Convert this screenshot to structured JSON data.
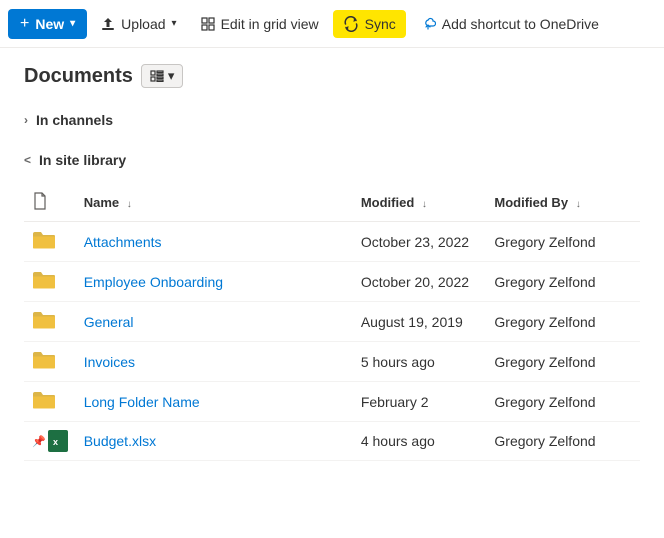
{
  "toolbar": {
    "new_label": "New",
    "upload_label": "Upload",
    "edit_grid_label": "Edit in grid view",
    "sync_label": "Sync",
    "add_shortcut_label": "Add shortcut to OneDrive"
  },
  "page": {
    "title": "Documents",
    "view_icon": "layout-icon",
    "view_dropdown": "▾"
  },
  "sections": [
    {
      "id": "in-channels",
      "label": "In channels",
      "expanded": false
    },
    {
      "id": "in-site-library",
      "label": "In site library",
      "expanded": true
    }
  ],
  "table": {
    "columns": [
      {
        "id": "name",
        "label": "Name",
        "sortable": true
      },
      {
        "id": "modified",
        "label": "Modified",
        "sortable": true
      },
      {
        "id": "modified_by",
        "label": "Modified By",
        "sortable": true
      }
    ],
    "rows": [
      {
        "id": "attachments",
        "type": "folder",
        "name": "Attachments",
        "modified": "October 23, 2022",
        "modified_by": "Gregory Zelfond"
      },
      {
        "id": "employee-onboarding",
        "type": "folder",
        "name": "Employee Onboarding",
        "modified": "October 20, 2022",
        "modified_by": "Gregory Zelfond"
      },
      {
        "id": "general",
        "type": "folder",
        "name": "General",
        "modified": "August 19, 2019",
        "modified_by": "Gregory Zelfond"
      },
      {
        "id": "invoices",
        "type": "folder",
        "name": "Invoices",
        "modified": "5 hours ago",
        "modified_by": "Gregory Zelfond"
      },
      {
        "id": "long-folder-name",
        "type": "folder",
        "name": "Long Folder Name",
        "modified": "February 2",
        "modified_by": "Gregory Zelfond"
      },
      {
        "id": "budget-xlsx",
        "type": "excel",
        "name": "Budget.xlsx",
        "modified": "4 hours ago",
        "modified_by": "Gregory Zelfond",
        "pinned": true
      }
    ]
  },
  "icons": {
    "plus": "+",
    "chevron_down": "⌵",
    "chevron_right": "›",
    "chevron_up": "˅",
    "sort_asc": "↑",
    "upload": "↑",
    "sync_symbol": "⟳"
  },
  "colors": {
    "accent_blue": "#0078d4",
    "sync_yellow": "#ffe500",
    "folder_yellow": "#dcb547",
    "excel_green": "#1d6f42"
  }
}
